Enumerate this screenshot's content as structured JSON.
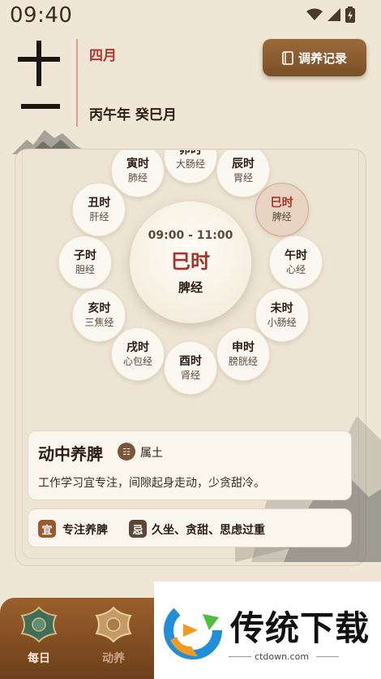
{
  "status_bar": {
    "time": "09:40"
  },
  "header": {
    "day_number": "十一",
    "month": "四月",
    "ganzhi": "丙午年 癸巳月",
    "record_button": "调养记录"
  },
  "clock": {
    "center": {
      "range": "09:00 - 11:00",
      "name": "巳时",
      "meridian": "脾经"
    },
    "items": [
      {
        "name": "寅时",
        "meridian": "肺经"
      },
      {
        "name": "卯时",
        "meridian": "大肠经"
      },
      {
        "name": "辰时",
        "meridian": "胃经"
      },
      {
        "name": "巳时",
        "meridian": "脾经",
        "active": true
      },
      {
        "name": "午时",
        "meridian": "心经"
      },
      {
        "name": "未时",
        "meridian": "小肠经"
      },
      {
        "name": "申时",
        "meridian": "膀胱经"
      },
      {
        "name": "酉时",
        "meridian": "肾经"
      },
      {
        "name": "戌时",
        "meridian": "心包经"
      },
      {
        "name": "亥时",
        "meridian": "三焦经"
      },
      {
        "name": "子时",
        "meridian": "胆经"
      },
      {
        "name": "丑时",
        "meridian": "肝经"
      }
    ]
  },
  "advice": {
    "title": "动中养脾",
    "element_icon": "earth-trigram-icon",
    "element_label": "属土",
    "text": "工作学习宜专注，间隙起身走动，少贪甜冷。"
  },
  "yiji": {
    "yi_badge": "宜",
    "yi_text": "专注养脾",
    "ji_badge": "忌",
    "ji_text": "久坐、贪甜、思虑过重"
  },
  "nav": {
    "items": [
      {
        "label": "每日",
        "icon": "jade-medallion-icon",
        "active": true
      },
      {
        "label": "动养",
        "icon": "medallion-icon",
        "active": false
      }
    ]
  },
  "ad": {
    "title": "传统下载",
    "subtitle": "ctdown.com"
  },
  "colors": {
    "accent": "#a8312a",
    "brand_brown": "#8a5a2f",
    "background": "#efe6d6"
  }
}
